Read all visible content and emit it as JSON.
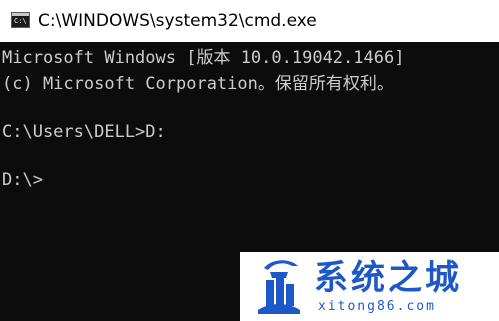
{
  "window": {
    "title": "C:\\WINDOWS\\system32\\cmd.exe",
    "icon": "cmd-icon"
  },
  "console": {
    "lines": [
      "Microsoft Windows [版本 10.0.19042.1466]",
      "(c) Microsoft Corporation。保留所有权利。",
      "",
      "C:\\Users\\DELL>D:",
      "",
      "D:\\>"
    ]
  },
  "watermark": {
    "brand": "系统之城",
    "url": "xitong86.com",
    "color": "#1e58c8"
  }
}
